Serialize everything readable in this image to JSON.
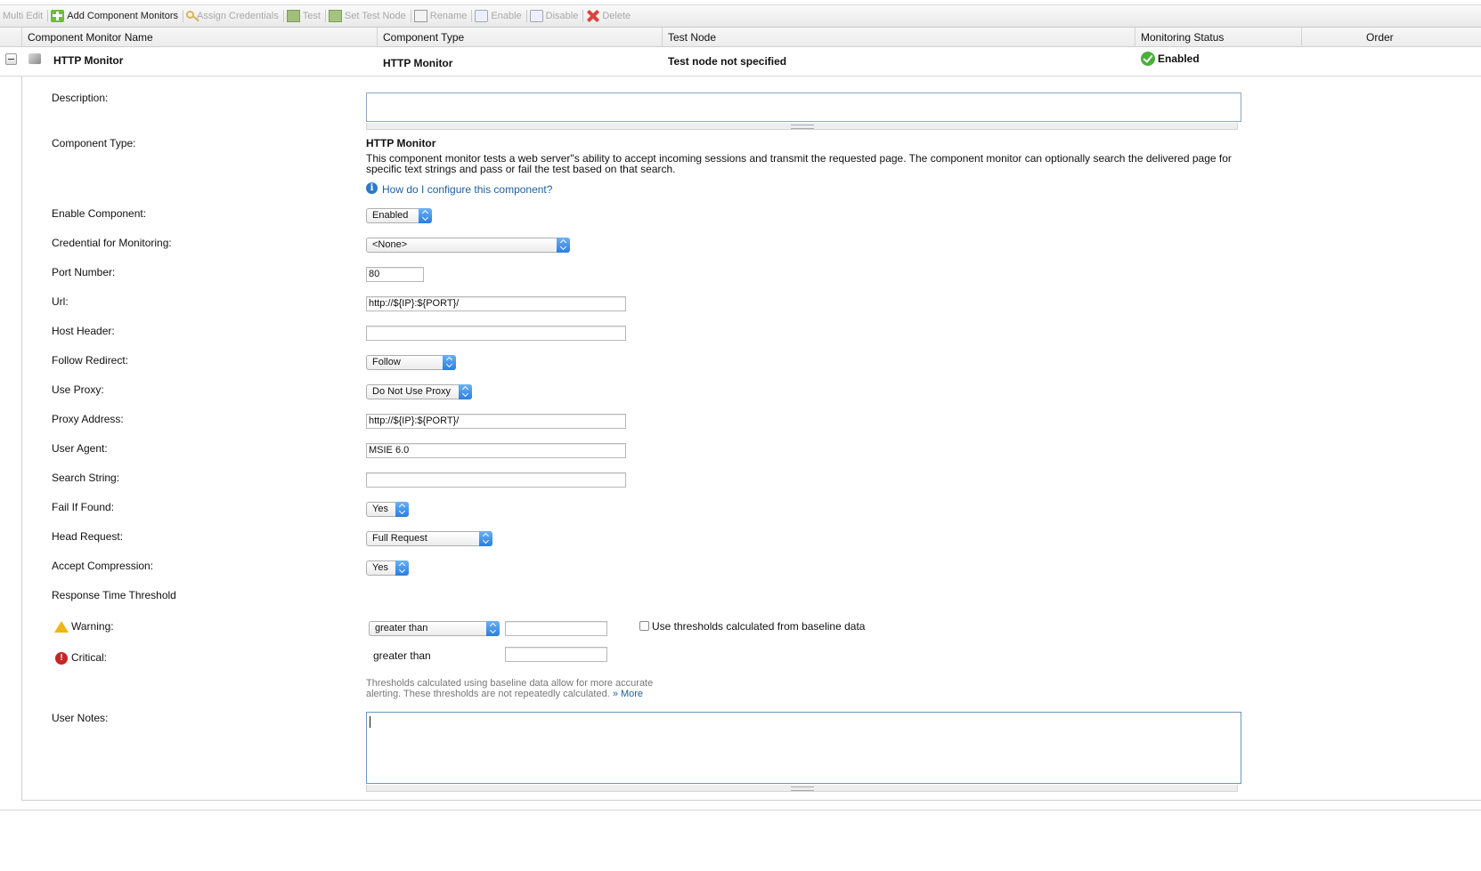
{
  "toolbar": {
    "multi_edit": "Multi Edit",
    "add_component_monitors": "Add Component Monitors",
    "assign_credentials": "Assign Credentials",
    "test": "Test",
    "set_test_node": "Set Test Node",
    "rename": "Rename",
    "enable": "Enable",
    "disable": "Disable",
    "delete": "Delete"
  },
  "grid": {
    "headers": {
      "name": "Component Monitor Name",
      "type": "Component Type",
      "test_node": "Test Node",
      "status": "Monitoring Status",
      "order": "Order"
    },
    "row": {
      "name": "HTTP Monitor",
      "type": "HTTP Monitor",
      "test_node": "Test node not specified",
      "status": "Enabled"
    }
  },
  "form": {
    "description_label": "Description:",
    "description_value": "",
    "component_type_label": "Component Type:",
    "component_type_title": "HTTP Monitor",
    "component_type_desc": "This component monitor tests a web server\"s ability to accept incoming sessions and transmit the requested page. The component monitor can optionally search the delivered page for specific text strings and pass or fail the test based on that search.",
    "help_link": "How do I configure this component?",
    "enable_label": "Enable Component:",
    "enable_value": "Enabled",
    "credential_label": "Credential for Monitoring:",
    "credential_value": "<None>",
    "port_label": "Port Number:",
    "port_value": "80",
    "url_label": "Url:",
    "url_value": "http://${IP}:${PORT}/",
    "host_header_label": "Host Header:",
    "host_header_value": "",
    "follow_redirect_label": "Follow Redirect:",
    "follow_redirect_value": "Follow",
    "use_proxy_label": "Use Proxy:",
    "use_proxy_value": "Do Not Use Proxy",
    "proxy_address_label": "Proxy Address:",
    "proxy_address_value": "http://${IP}:${PORT}/",
    "user_agent_label": "User Agent:",
    "user_agent_value": "MSIE 6.0",
    "search_string_label": "Search String:",
    "search_string_value": "",
    "fail_if_found_label": "Fail If Found:",
    "fail_if_found_value": "Yes",
    "head_request_label": "Head Request:",
    "head_request_value": "Full Request",
    "accept_compression_label": "Accept Compression:",
    "accept_compression_value": "Yes",
    "response_threshold_label": "Response Time Threshold",
    "warning_label": "Warning:",
    "warning_operator": "greater than",
    "warning_value": "",
    "baseline_checkbox_label": "Use thresholds calculated from baseline data",
    "critical_label": "Critical:",
    "critical_operator": "greater than",
    "critical_value": "",
    "baseline_note_line1": "Thresholds calculated using baseline data allow for more accurate",
    "baseline_note_line2": "alerting. These thresholds are not repeatedly calculated.",
    "more_link": "» More",
    "user_notes_label": "User Notes:",
    "user_notes_value": ""
  }
}
